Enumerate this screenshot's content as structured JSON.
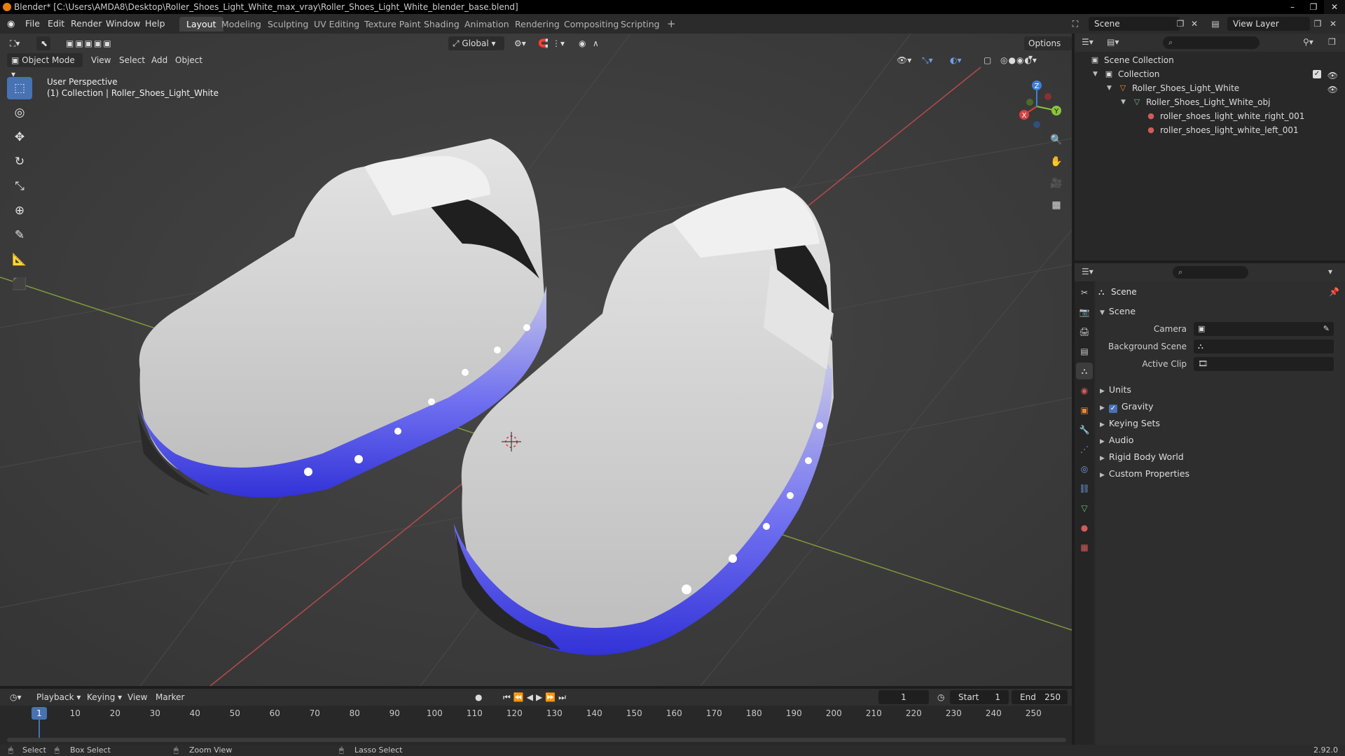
{
  "window": {
    "title": "Blender* [C:\\Users\\AMDA8\\Desktop\\Roller_Shoes_Light_White_max_vray\\Roller_Shoes_Light_White_blender_base.blend]",
    "min": "–",
    "max": "❐",
    "close": "✕"
  },
  "menu": [
    "File",
    "Edit",
    "Render",
    "Window",
    "Help"
  ],
  "workspaces": [
    "Layout",
    "Modeling",
    "Sculpting",
    "UV Editing",
    "Texture Paint",
    "Shading",
    "Animation",
    "Rendering",
    "Compositing",
    "Scripting"
  ],
  "workspace_add": "+",
  "scene_name": "Scene",
  "view_layer": "View Layer",
  "viewport": {
    "mode": "Object Mode",
    "menus": [
      "View",
      "Select",
      "Add",
      "Object"
    ],
    "transform_orientation": "Global",
    "options": "Options",
    "info_line1": "User Perspective",
    "info_line2": "(1) Collection | Roller_Shoes_Light_White",
    "gizmo": {
      "x": "X",
      "y": "Y",
      "z": "Z"
    }
  },
  "tools": [
    "select-box-icon",
    "cursor-icon",
    "move-icon",
    "rotate-icon",
    "scale-icon",
    "transform-icon",
    "annotate-icon",
    "measure-icon",
    "add-cube-icon"
  ],
  "outliner": {
    "root": "Scene Collection",
    "items": [
      {
        "label": "Collection"
      },
      {
        "label": "Roller_Shoes_Light_White"
      },
      {
        "label": "Roller_Shoes_Light_White_obj"
      },
      {
        "label": "roller_shoes_light_white_right_001"
      },
      {
        "label": "roller_shoes_light_white_left_001"
      }
    ]
  },
  "properties": {
    "title": "Scene",
    "panel": "Scene",
    "camera_label": "Camera",
    "background_label": "Background Scene",
    "clip_label": "Active Clip",
    "subpanels": [
      "Units",
      "Gravity",
      "Keying Sets",
      "Audio",
      "Rigid Body World",
      "Custom Properties"
    ]
  },
  "timeline": {
    "menus": [
      "Playback",
      "Keying",
      "View",
      "Marker"
    ],
    "current_frame": "1",
    "start_label": "Start",
    "start": "1",
    "end_label": "End",
    "end": "250",
    "ticks": [
      "1",
      "10",
      "20",
      "30",
      "40",
      "50",
      "60",
      "70",
      "80",
      "90",
      "100",
      "110",
      "120",
      "130",
      "140",
      "150",
      "160",
      "170",
      "180",
      "190",
      "200",
      "210",
      "220",
      "230",
      "240",
      "250"
    ]
  },
  "status": {
    "select": "Select",
    "box_select": "Box Select",
    "zoom_view": "Zoom View",
    "lasso_select": "Lasso Select",
    "version": "2.92.0"
  },
  "colors": {
    "accent": "#4772b3",
    "sole_glow": "#3a3ae0",
    "x_axis": "#d94040",
    "y_axis": "#8ac43c",
    "z_axis": "#3f7fd9"
  }
}
